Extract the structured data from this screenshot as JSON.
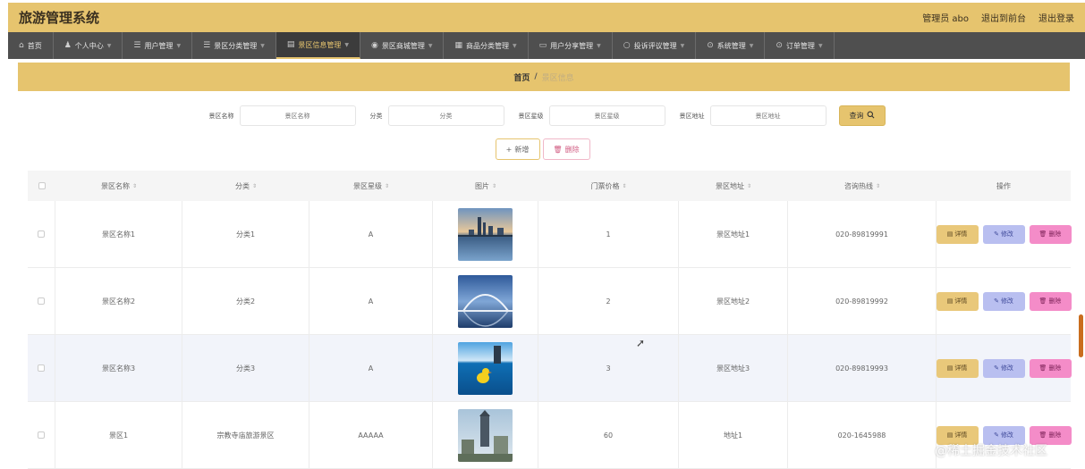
{
  "header": {
    "title": "旅游管理系统",
    "user_label": "管理员 abo",
    "front_label": "退出到前台",
    "logout_label": "退出登录"
  },
  "nav": {
    "items": [
      {
        "label": "首页",
        "icon": "home-icon",
        "glyph": "⌂"
      },
      {
        "label": "个人中心",
        "icon": "person-icon",
        "glyph": "♟"
      },
      {
        "label": "用户管理",
        "icon": "list-icon",
        "glyph": "☰"
      },
      {
        "label": "景区分类管理",
        "icon": "list-icon",
        "glyph": "☰"
      },
      {
        "label": "景区信息管理",
        "icon": "chart-icon",
        "glyph": "▤"
      },
      {
        "label": "景区商城管理",
        "icon": "location-icon",
        "glyph": "◉"
      },
      {
        "label": "商品分类管理",
        "icon": "document-icon",
        "glyph": "▦"
      },
      {
        "label": "用户分享管理",
        "icon": "image-icon",
        "glyph": "▭"
      },
      {
        "label": "投诉评议管理",
        "icon": "circle-icon",
        "glyph": "○"
      },
      {
        "label": "系统管理",
        "icon": "settings-icon",
        "glyph": "⊙"
      },
      {
        "label": "订单管理",
        "icon": "order-icon",
        "glyph": "⊙"
      }
    ]
  },
  "breadcrumb": {
    "home": "首页",
    "separator": "/",
    "current": "景区信息"
  },
  "search": {
    "name_label": "景区名称",
    "name_placeholder": "景区名称",
    "category_label": "分类",
    "category_placeholder": "分类",
    "level_label": "景区星级",
    "level_placeholder": "景区星级",
    "address_label": "景区地址",
    "address_placeholder": "景区地址",
    "button_label": "查询",
    "button_icon": "search-icon"
  },
  "actions": {
    "add_label": "新增",
    "delete_label": "删除"
  },
  "table": {
    "columns": [
      "景区名称",
      "分类",
      "景区星级",
      "图片",
      "门票价格",
      "景区地址",
      "咨询热线",
      "操作"
    ],
    "sort_glyph": "⇕",
    "rows": [
      {
        "name": "景区名称1",
        "category": "分类1",
        "level": "A",
        "price": "1",
        "address": "景区地址1",
        "phone": "020-89819991",
        "image": "city-skyline-sunset"
      },
      {
        "name": "景区名称2",
        "category": "分类2",
        "level": "A",
        "price": "2",
        "address": "景区地址2",
        "phone": "020-89819992",
        "image": "arch-bridge-water"
      },
      {
        "name": "景区名称3",
        "category": "分类3",
        "level": "A",
        "price": "3",
        "address": "景区地址3",
        "phone": "020-89819993",
        "image": "pool-yellow-duck"
      },
      {
        "name": "景区1",
        "category": "宗教寺庙旅游景区",
        "level": "AAAAA",
        "price": "60",
        "address": "地址1",
        "phone": "020-1645988",
        "image": "pagoda-tower-city"
      }
    ],
    "row_actions": {
      "detail_label": "详情",
      "edit_label": "修改",
      "delete_label": "删除"
    }
  },
  "colors": {
    "accent": "#e6c46e",
    "nav_bg": "#4f4f4f",
    "edit_btn": "#b9bff0",
    "delete_btn": "#f48cc8"
  },
  "watermark": "@稀土掘金技术社区"
}
